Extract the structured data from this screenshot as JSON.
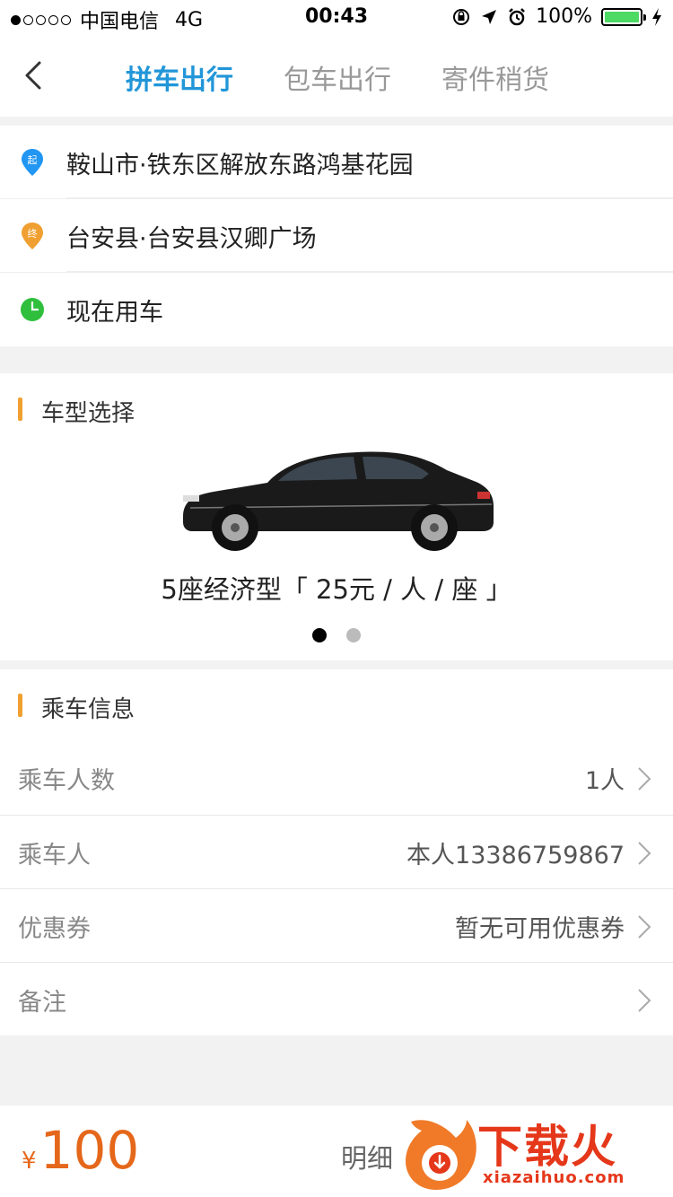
{
  "status_bar": {
    "carrier": "中国电信",
    "network": "4G",
    "time": "00:43",
    "battery": "100%",
    "signal_bars_filled": 1,
    "signal_bars_total": 5
  },
  "nav": {
    "tabs": [
      {
        "label": "拼车出行",
        "active": true
      },
      {
        "label": "包车出行",
        "active": false
      },
      {
        "label": "寄件稍货",
        "active": false
      }
    ]
  },
  "route": {
    "start_badge": "起",
    "start": "鞍山市·铁东区解放东路鸿基花园",
    "end_badge": "终",
    "end": "台安县·台安县汉卿广场",
    "time": "现在用车"
  },
  "car_selection": {
    "title": "车型选择",
    "description": "5座经济型「 25元 / 人 / 座 」",
    "pages": 2,
    "current_page": 1
  },
  "ride_info": {
    "title": "乘车信息",
    "rows": [
      {
        "key": "乘车人数",
        "value": "1人"
      },
      {
        "key": "乘车人",
        "value": "本人13386759867"
      },
      {
        "key": "优惠券",
        "value": "暂无可用优惠券"
      },
      {
        "key": "备注",
        "value": ""
      }
    ]
  },
  "bottom": {
    "currency": "¥",
    "price": "100",
    "detail": "明细"
  },
  "watermark": {
    "brand": "下载火",
    "url": "xiazaihuo.com"
  },
  "colors": {
    "accent": "#2196d8",
    "price": "#e5671a",
    "section_bar": "#f0a030",
    "start_pin": "#2196f3",
    "end_pin": "#f0a030",
    "time_icon": "#2fbf3c"
  }
}
